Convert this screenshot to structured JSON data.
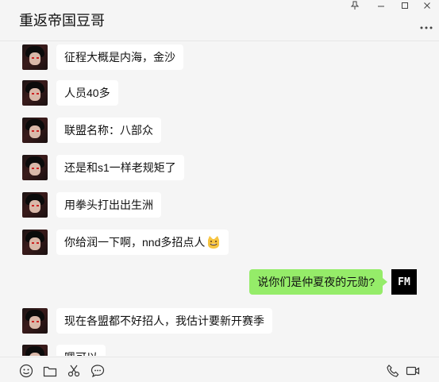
{
  "window": {
    "title": "重返帝国豆哥",
    "pin_icon": "pin-icon",
    "minimize_icon": "minimize-icon",
    "maximize_icon": "maximize-icon",
    "close_icon": "close-icon",
    "more_icon": "more-icon"
  },
  "messages": [
    {
      "side": "left",
      "text": "征程大概是内海，金沙"
    },
    {
      "side": "left",
      "text": "人员40多"
    },
    {
      "side": "left",
      "text": "联盟名称：八部众"
    },
    {
      "side": "left",
      "text": "还是和s1一样老规矩了"
    },
    {
      "side": "left",
      "text": "用拳头打出出生洲"
    },
    {
      "side": "left",
      "text": "你给润一下啊，nnd多招点人",
      "emoji": "grinning-cat-emoji"
    },
    {
      "side": "right",
      "text": "说你们是仲夏夜的元勋?",
      "avatar_label": "FM"
    },
    {
      "side": "left",
      "text": "现在各盟都不好招人，我估计要新开赛季"
    },
    {
      "side": "left",
      "text": "嗯可以"
    }
  ],
  "toolbar": {
    "left": [
      "emoji-icon",
      "folder-icon",
      "scissors-icon",
      "chat-bubble-icon"
    ],
    "right": [
      "phone-icon",
      "video-call-icon"
    ]
  },
  "colors": {
    "self_bubble": "#95ec69",
    "other_bubble": "#ffffff",
    "background": "#f5f5f5"
  }
}
